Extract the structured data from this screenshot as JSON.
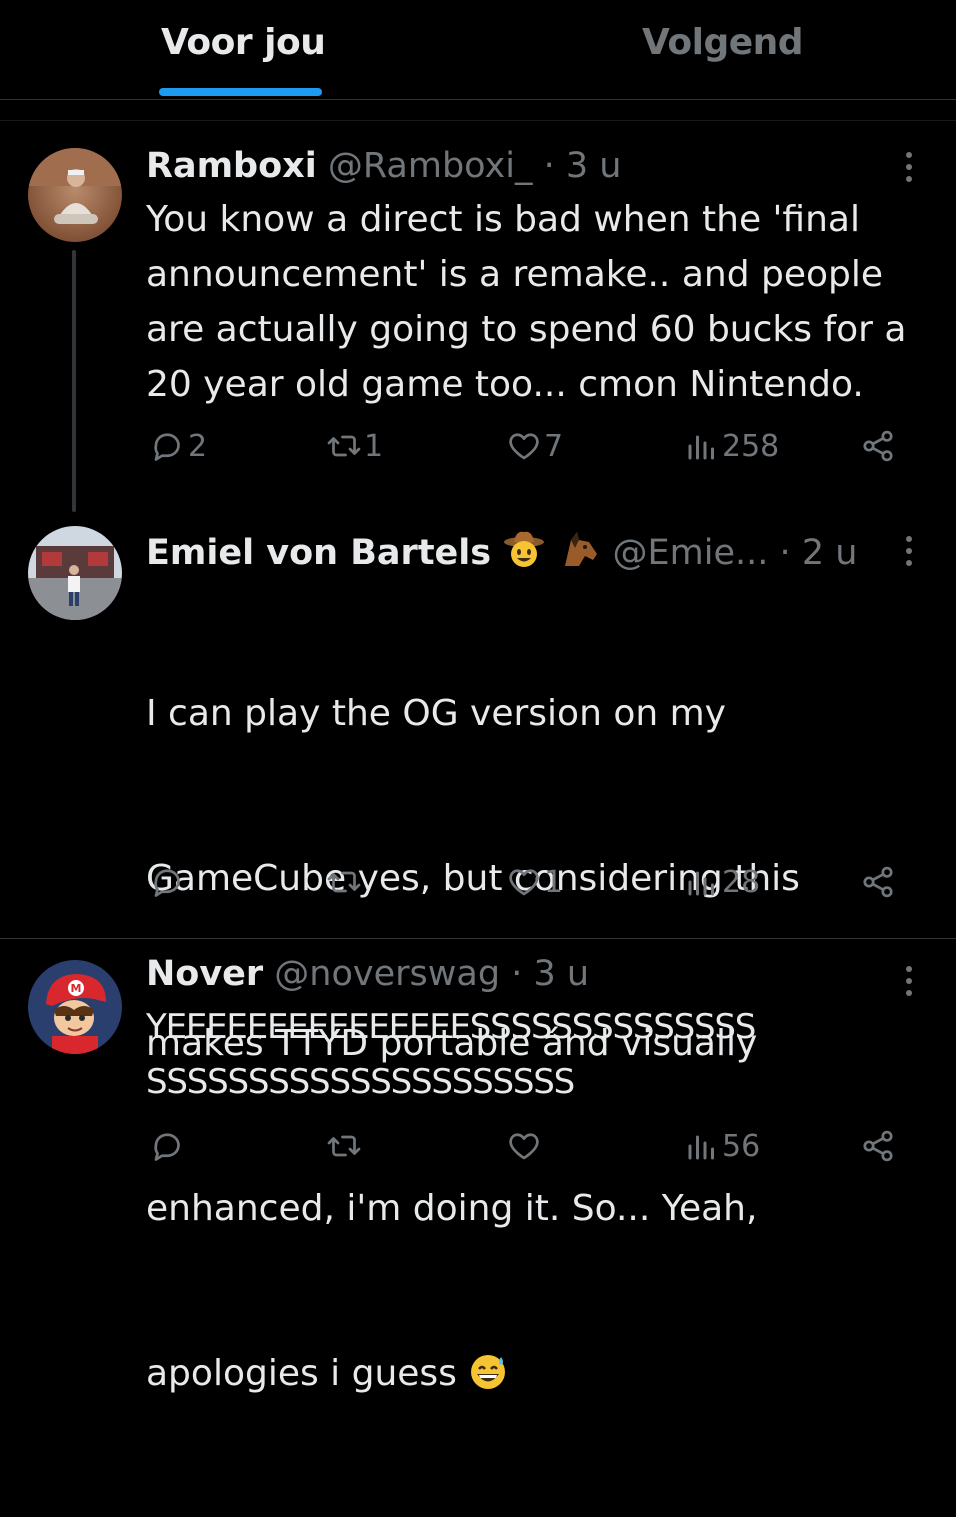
{
  "tabs": [
    {
      "label": "Voor jou",
      "active": true
    },
    {
      "label": "Volgend",
      "active": false
    }
  ],
  "tweets": [
    {
      "name": "Ramboxi",
      "handle": "@Ramboxi_",
      "separator": "·",
      "time": "3 u",
      "text": "You know a direct is bad when the 'final\nannouncement' is a remake.. and people\nare actually going to spend 60 bucks for a\n20 year old game too... cmon Nintendo.",
      "replies": "2",
      "retweets": "1",
      "likes": "7",
      "views": "258"
    },
    {
      "name": "Emiel von Bartels",
      "name_emoji": [
        "cowboy-hat-face",
        "horse-face"
      ],
      "handle": "@Emie...",
      "separator": "·",
      "time": "2 u",
      "text_lines": [
        "I can play the OG version on my",
        "GameCube yes, but considering this",
        "makes TTYD portable ánd visually",
        "enhanced, i'm doing it. So... Yeah,",
        "apologies i guess"
      ],
      "text_emoji": "grinning-sweat-face",
      "replies": "",
      "retweets": "",
      "likes": "1",
      "views": "28"
    },
    {
      "name": "Nover",
      "handle": "@noverswag",
      "separator": "·",
      "time": "3 u",
      "text": "YEEEEEEEEEEEEEEESSSSSSSSSSSSSS\nSSSSSSSSSSSSSSSSSSSSS",
      "replies": "",
      "retweets": "",
      "likes": "",
      "views": "56"
    }
  ],
  "colors": {
    "background": "#000000",
    "text": "#e7e9ea",
    "secondary": "#71767b",
    "accent": "#1d9bf0",
    "divider": "#2f3336"
  }
}
